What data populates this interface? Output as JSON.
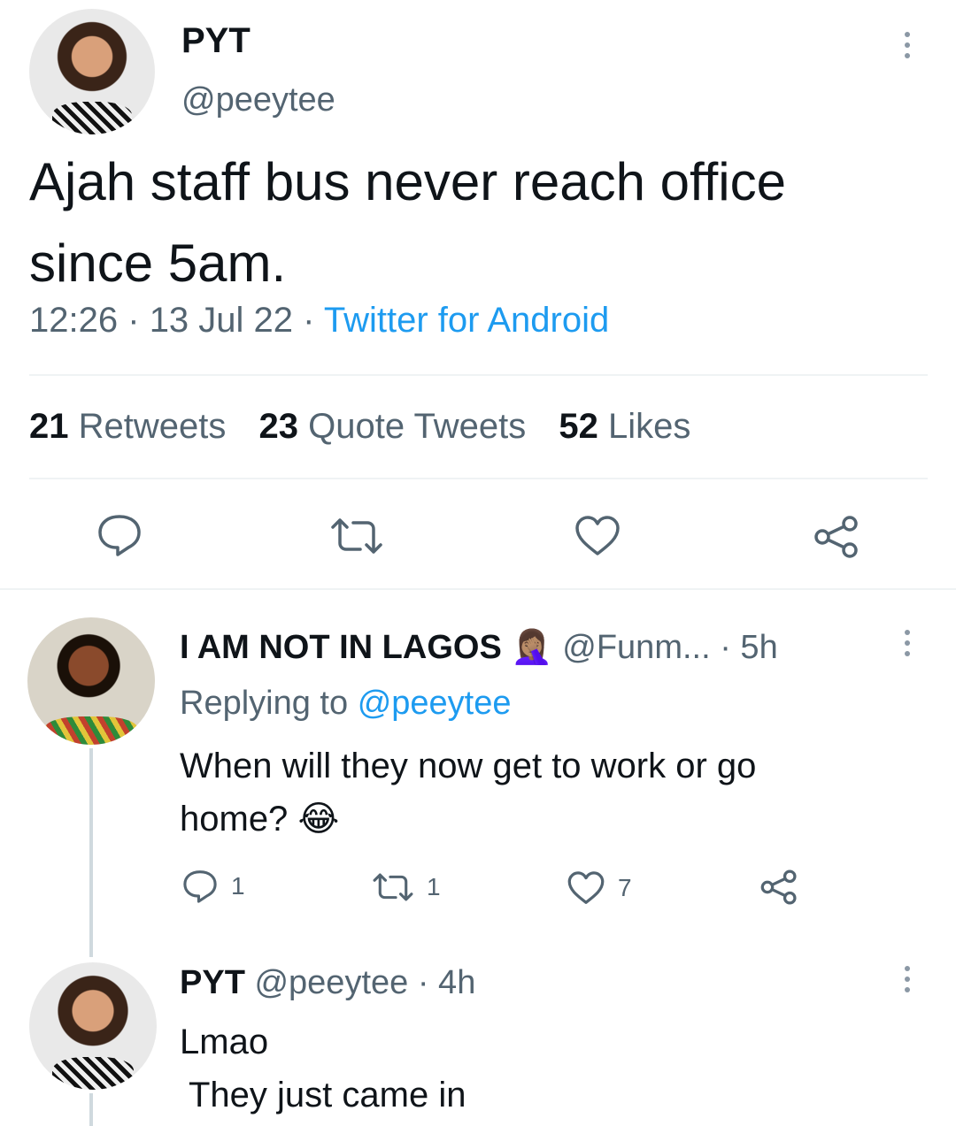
{
  "main_tweet": {
    "display_name": "PYT",
    "handle": "@peeytee",
    "text_line1": "Ajah staff bus never reach office",
    "text_line2": "since 5am.",
    "time": "12:26",
    "date": "13 Jul 22",
    "source": "Twitter for Android",
    "separator": "·",
    "stats": {
      "retweets_count": "21",
      "retweets_label": "Retweets",
      "quotes_count": "23",
      "quotes_label": "Quote Tweets",
      "likes_count": "52",
      "likes_label": "Likes"
    }
  },
  "reply1": {
    "display_name": "I AM NOT IN LAGOS",
    "name_emoji": "🤦🏽‍♀️",
    "handle": "@Funm...",
    "time": "· 5h",
    "replying_prefix": "Replying to",
    "replying_handle": "@peeytee",
    "text_line1": "When will they now get to work or go",
    "text_line2": "home?",
    "text_emoji": "😂",
    "reply_count": "1",
    "retweet_count": "1",
    "like_count": "7"
  },
  "reply2": {
    "display_name": "PYT",
    "handle": "@peeytee",
    "time": "· 4h",
    "text_line1": "Lmao",
    "text_line2": "They just came in"
  },
  "colors": {
    "accent": "#1d9bf0",
    "text": "#0f1419",
    "secondary": "#536471"
  }
}
